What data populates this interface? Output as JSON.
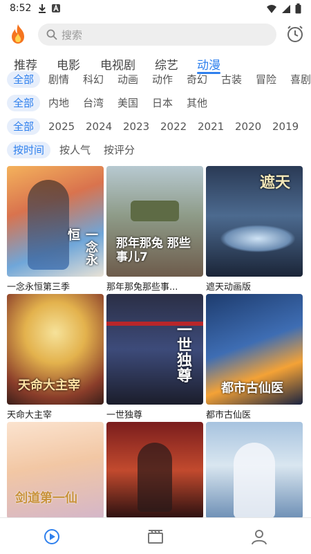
{
  "status": {
    "time": "8:52"
  },
  "search": {
    "placeholder": "搜索"
  },
  "tabs": [
    {
      "label": "推荐"
    },
    {
      "label": "电影"
    },
    {
      "label": "电视剧"
    },
    {
      "label": "综艺"
    },
    {
      "label": "动漫"
    }
  ],
  "filters": {
    "genre": [
      "全部",
      "剧情",
      "科幻",
      "动画",
      "动作",
      "奇幻",
      "古装",
      "冒险",
      "喜剧"
    ],
    "region": [
      "全部",
      "内地",
      "台湾",
      "美国",
      "日本",
      "其他"
    ],
    "year": [
      "全部",
      "2025",
      "2024",
      "2023",
      "2022",
      "2021",
      "2020",
      "2019"
    ],
    "sort": [
      "按时间",
      "按人气",
      "按评分"
    ]
  },
  "cards": [
    {
      "title": "一念永恒第三季",
      "poster_text": "一念永恒"
    },
    {
      "title": "那年那兔那些事...",
      "poster_text": "那年那兔 那些事儿7"
    },
    {
      "title": "遮天动画版",
      "poster_text": "遮天"
    },
    {
      "title": "天命大主宰",
      "poster_text": "天命大主宰"
    },
    {
      "title": "一世独尊",
      "poster_text": "一世独尊"
    },
    {
      "title": "都市古仙医",
      "poster_text": "都市古仙医"
    },
    {
      "title": "",
      "poster_text": "剑道第一仙"
    },
    {
      "title": "",
      "poster_text": ""
    },
    {
      "title": "",
      "poster_text": ""
    }
  ],
  "colors": {
    "accent": "#2f80ed",
    "chip_bg": "#e6eefb",
    "search_bg": "#eeeeee"
  },
  "icons": {
    "nav": [
      "play-icon",
      "clapperboard-icon",
      "person-icon"
    ],
    "topbar": [
      "flame-logo-icon",
      "search-icon",
      "history-clock-icon"
    ]
  }
}
